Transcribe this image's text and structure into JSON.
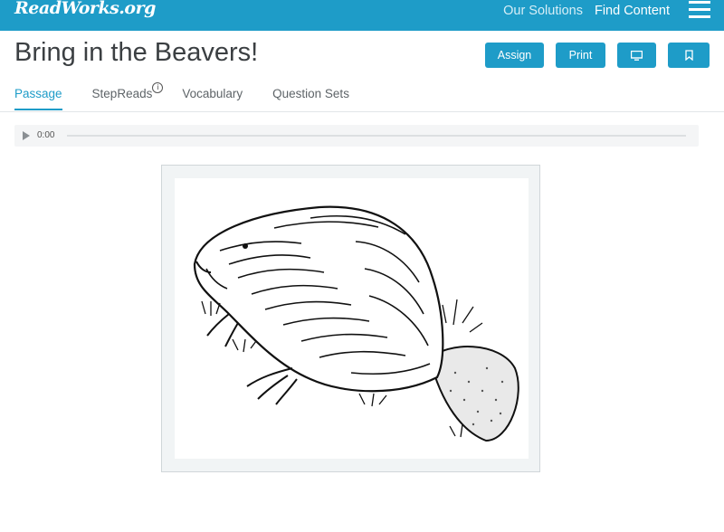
{
  "header": {
    "logo": "ReadWorks.org",
    "nav": [
      "Our Solutions",
      "Find Content"
    ],
    "menu_icon": "hamburger-icon"
  },
  "article": {
    "title": "Bring in the Beavers!",
    "buttons": {
      "assign": "Assign",
      "print": "Print",
      "present_icon": "monitor-icon",
      "bookmark_icon": "bookmark-icon"
    },
    "tabs": [
      {
        "label": "Passage",
        "active": true
      },
      {
        "label": "StepReads",
        "info_icon": "info-icon"
      },
      {
        "label": "Vocabulary"
      },
      {
        "label": "Question Sets"
      }
    ]
  },
  "audio": {
    "time": "0:00",
    "play_icon": "play-icon",
    "progress": 0
  },
  "figure": {
    "image": "beaver-illustration"
  },
  "colors": {
    "brand": "#1e9cc8",
    "title": "#3b3f42"
  }
}
